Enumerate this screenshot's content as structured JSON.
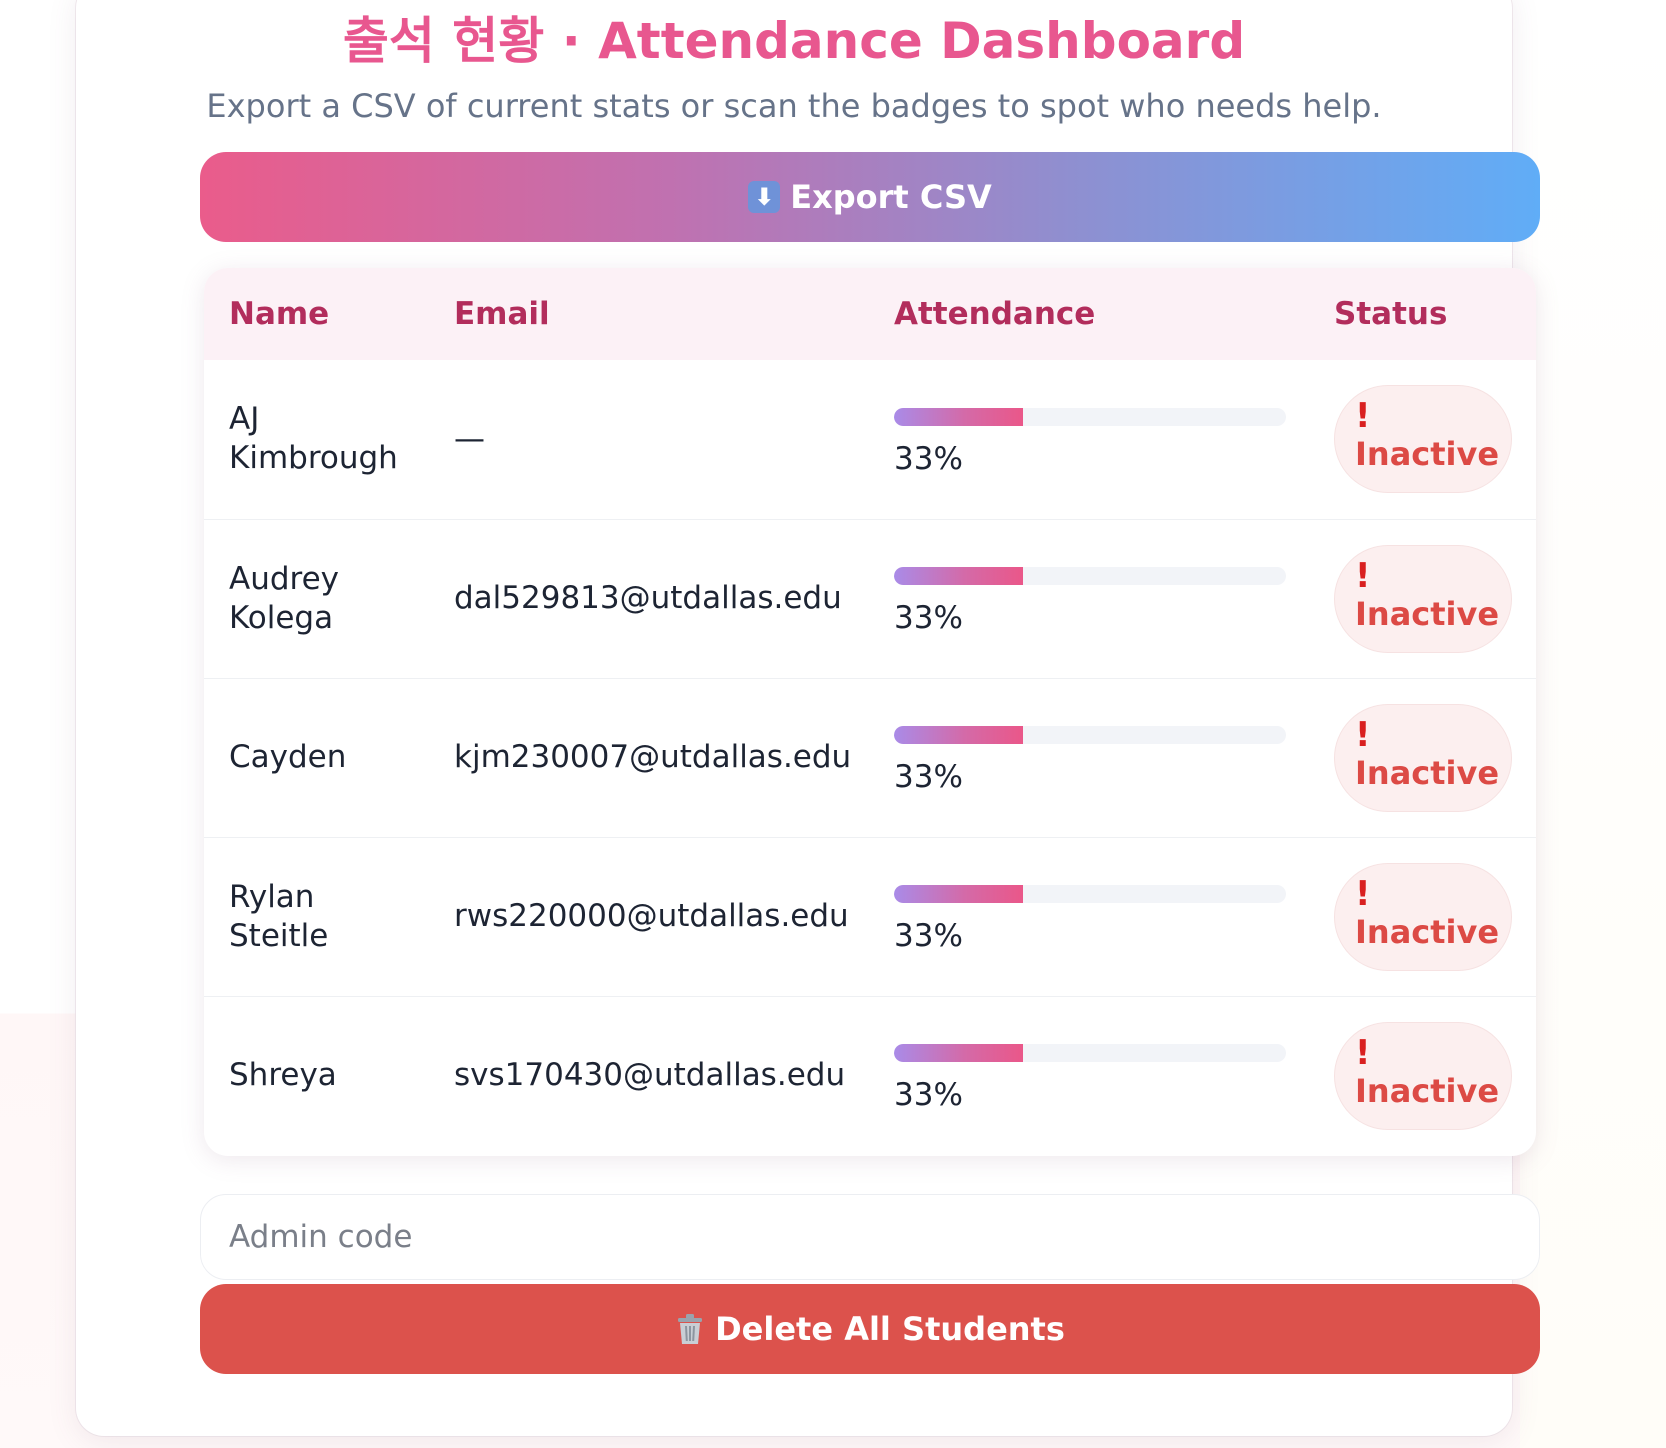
{
  "header": {
    "title": "출석 현황 · Attendance Dashboard",
    "subtitle": "Export a CSV of current stats or scan the badges to spot who needs help."
  },
  "export_button": {
    "icon": "down-arrow-icon",
    "label": "Export CSV"
  },
  "table": {
    "columns": [
      "Name",
      "Email",
      "Attendance",
      "Status"
    ],
    "rows": [
      {
        "name": "AJ Kimbrough",
        "email": "—",
        "attendance_label": "33%",
        "attendance_fraction": 0.33,
        "status_icon": "!",
        "status": "Inactive"
      },
      {
        "name": "Audrey Kolega",
        "email": "dal529813@utdallas.edu",
        "attendance_label": "33%",
        "attendance_fraction": 0.33,
        "status_icon": "!",
        "status": "Inactive"
      },
      {
        "name": "Cayden",
        "email": "kjm230007@utdallas.edu",
        "attendance_label": "33%",
        "attendance_fraction": 0.33,
        "status_icon": "!",
        "status": "Inactive"
      },
      {
        "name": "Rylan Steitle",
        "email": "rws220000@utdallas.edu",
        "attendance_label": "33%",
        "attendance_fraction": 0.33,
        "status_icon": "!",
        "status": "Inactive"
      },
      {
        "name": "Shreya",
        "email": "svs170430@utdallas.edu",
        "attendance_label": "33%",
        "attendance_fraction": 0.33,
        "status_icon": "!",
        "status": "Inactive"
      }
    ]
  },
  "admin": {
    "placeholder": "Admin code",
    "value": ""
  },
  "delete_button": {
    "icon": "trash-icon",
    "label": "Delete All Students"
  },
  "colors": {
    "title": "#e8578f",
    "header_text": "#b22d5c",
    "status_text": "#dc4a45",
    "delete_button": "#dc524c",
    "export_gradient_start": "#ea5c8b",
    "export_gradient_end": "#60adf7"
  }
}
